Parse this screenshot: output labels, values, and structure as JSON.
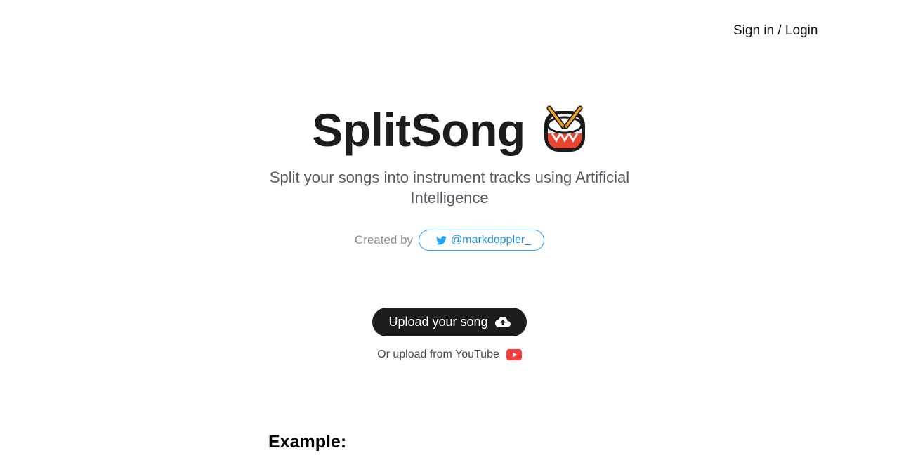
{
  "header": {
    "signin_label": "Sign in / Login"
  },
  "hero": {
    "title": "SplitSong",
    "title_icon": "drum-icon",
    "subtitle": "Split your songs into instrument tracks using Artificial Intelligence"
  },
  "credit": {
    "label": "Created by",
    "handle": "@markdoppler_",
    "icon": "twitter-bird-icon",
    "accent_color": "#1da1f2"
  },
  "upload": {
    "button_label": "Upload your song",
    "button_icon": "cloud-upload-icon",
    "button_color": "#1c1c1e",
    "youtube_label": "Or upload from YouTube",
    "youtube_icon": "youtube-icon",
    "youtube_color": "#ff3b3b"
  },
  "example": {
    "heading": "Example:"
  }
}
